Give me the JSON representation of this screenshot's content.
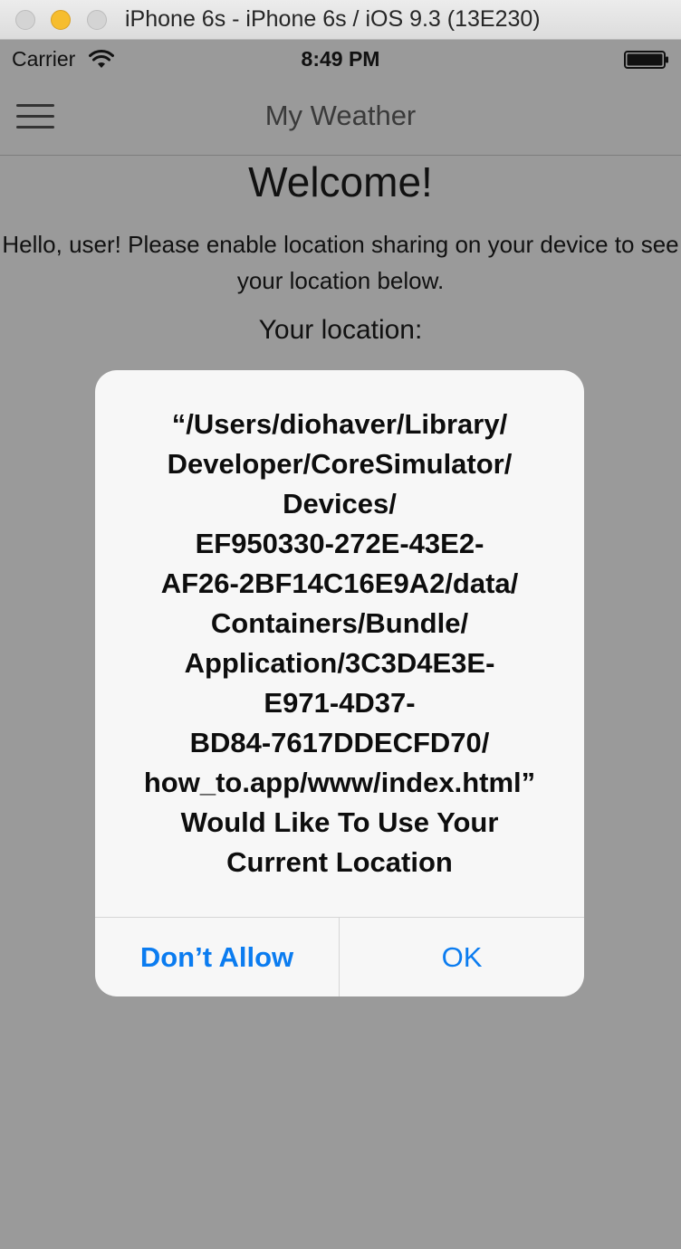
{
  "window": {
    "title": "iPhone 6s - iPhone 6s / iOS 9.3 (13E230)"
  },
  "status_bar": {
    "carrier": "Carrier",
    "time": "8:49 PM",
    "wifi_icon": "wifi-icon",
    "battery_icon": "battery-icon"
  },
  "nav": {
    "menu_icon": "hamburger-menu-icon",
    "title": "My Weather"
  },
  "page": {
    "welcome": "Welcome!",
    "intro": "Hello, user! Please enable location sharing on your device to see your location below.",
    "location_heading": "Your location:"
  },
  "alert": {
    "message": "“/Users/diohaver/Library/\nDeveloper/CoreSimulator/\nDevices/\nEF950330-272E-43E2-\nAF26-2BF14C16E9A2/data/\nContainers/Bundle/\nApplication/3C3D4E3E-\nE971-4D37-\nBD84-7617DDECFD70/\nhow_to.app/www/index.html”\nWould Like To Use Your\nCurrent Location",
    "deny_label": "Don’t Allow",
    "ok_label": "OK"
  },
  "colors": {
    "accent": "#0b7cf0",
    "dim_overlay": "#9a9a9a",
    "alert_bg": "#f7f7f7"
  }
}
